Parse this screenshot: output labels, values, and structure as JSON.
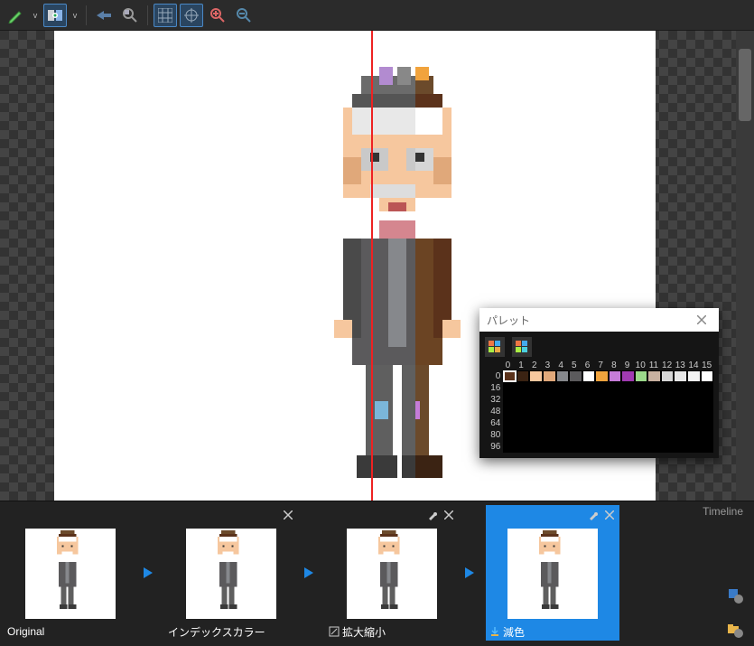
{
  "toolbar": {
    "pencil": "pencil",
    "eye_compare": "compare-view",
    "back": "back",
    "magnify_search": "find",
    "grid": "grid",
    "crosshair": "crosshair",
    "zoom_in": "zoom-in",
    "zoom_out": "zoom-out"
  },
  "palette": {
    "title": "パレット",
    "cols": [
      "0",
      "1",
      "2",
      "3",
      "4",
      "5",
      "6",
      "7",
      "8",
      "9",
      "10",
      "11",
      "12",
      "13",
      "14",
      "15"
    ],
    "rows": [
      "0",
      "16",
      "32",
      "48",
      "64",
      "80",
      "96"
    ],
    "colors_row0": [
      "#5b321b",
      "#3b2313",
      "#f6c79e",
      "#e0a87a",
      "#86888c",
      "#5b5a5c",
      "#ffffff",
      "#f1a33d",
      "#c57cd8",
      "#a03bb2",
      "#9bd98a",
      "#c8b1a0",
      "#d6d6d6",
      "#e6e6e6",
      "#f3f3f3",
      "#ffffff"
    ]
  },
  "timeline": {
    "title": "Timeline",
    "cards": [
      {
        "label": "Original",
        "closable": false,
        "gear": false
      },
      {
        "label": "インデックスカラー",
        "closable": true,
        "gear": false
      },
      {
        "label": "拡大縮小",
        "closable": true,
        "gear": true,
        "icon": "resize"
      },
      {
        "label": "減色",
        "closable": true,
        "gear": true,
        "icon": "reduce",
        "selected": true
      }
    ]
  }
}
